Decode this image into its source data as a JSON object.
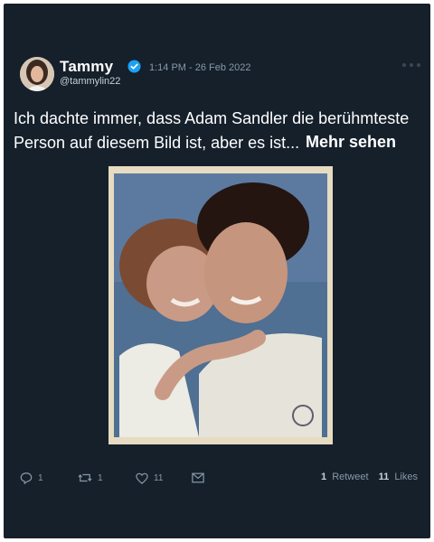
{
  "tweet": {
    "author_name": "Tammy",
    "author_handle": "@tammylin22",
    "timestamp": "1:14 PM - 26 Feb 2022",
    "text": "Ich dachte immer, dass Adam Sandler die berühmteste Person auf diesem Bild ist, aber es ist...",
    "see_more": "Mehr sehen",
    "icons": {
      "verified": "verified-badge-icon",
      "more": "more-options-icon",
      "reply": "reply-icon",
      "retweet": "retweet-icon",
      "like": "like-icon",
      "share": "share-mail-icon"
    }
  },
  "actions": {
    "reply_count": "1",
    "retweet_count": "1",
    "like_count": "11"
  },
  "stats": {
    "retweets_value": "1",
    "retweets_label": "Retweet",
    "likes_value": "11",
    "likes_label": "Likes"
  },
  "colors": {
    "background": "#15202b",
    "verified": "#1da1f2",
    "muted": "#8899a6",
    "text": "#ffffff"
  }
}
